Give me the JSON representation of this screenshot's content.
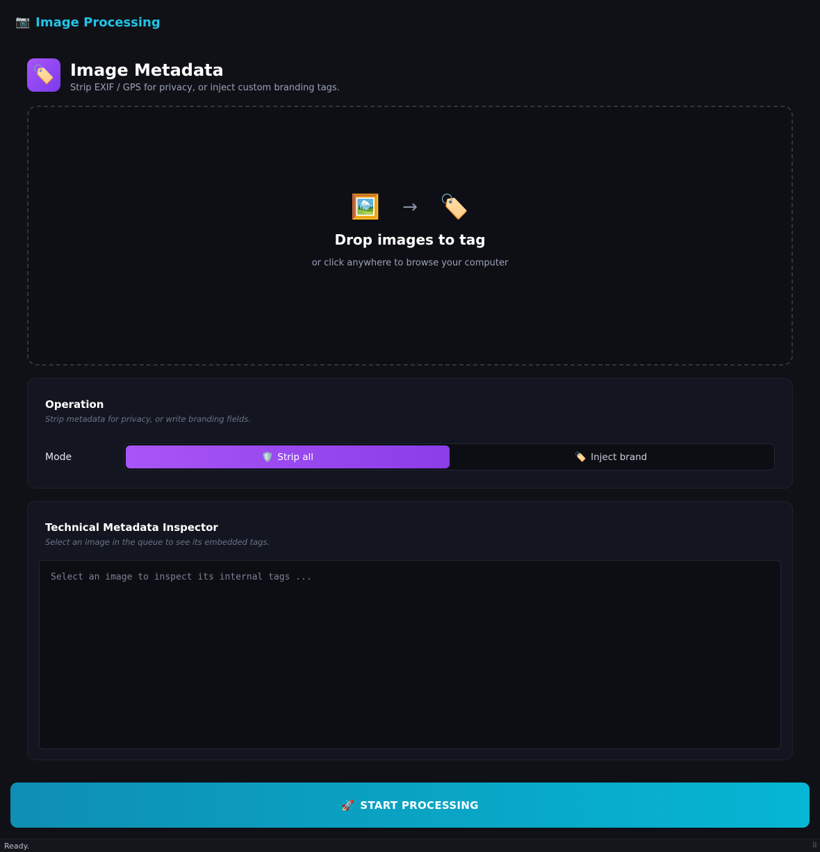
{
  "app": {
    "title": "Image Processing",
    "title_icon": "camera-icon",
    "title_icon_glyph": "📷"
  },
  "header": {
    "icon": "tag-icon",
    "icon_glyph": "🏷️",
    "title": "Image Metadata",
    "subtitle": "Strip EXIF / GPS for privacy, or inject custom branding tags."
  },
  "dropzone": {
    "icon_from": "framed-picture-icon",
    "icon_from_glyph": "🖼️",
    "arrow": "→",
    "icon_to": "tag-icon",
    "icon_to_glyph": "🏷️",
    "title": "Drop images to tag",
    "subtitle": "or click anywhere to browse your computer"
  },
  "operation": {
    "title": "Operation",
    "subtitle": "Strip metadata for privacy, or write branding fields.",
    "mode_label": "Mode",
    "options": [
      {
        "icon": "shield-icon",
        "glyph": "🛡️",
        "label": "Strip all",
        "active": true
      },
      {
        "icon": "tag-icon",
        "glyph": "🏷️",
        "label": "Inject brand",
        "active": false
      }
    ]
  },
  "inspector": {
    "title": "Technical Metadata Inspector",
    "subtitle": "Select an image in the queue to see its embedded tags.",
    "placeholder": "Select an image to inspect its internal tags ..."
  },
  "actions": {
    "start_icon": "rocket-icon",
    "start_glyph": "🚀",
    "start_label": "START PROCESSING"
  },
  "status": {
    "text": "Ready.",
    "grip_glyph": "⠿"
  },
  "colors": {
    "background": "#0f1117",
    "accent_cyan": "#22c3e6",
    "accent_purple": "#a855f7",
    "button_cyan": "#06b6d4"
  }
}
